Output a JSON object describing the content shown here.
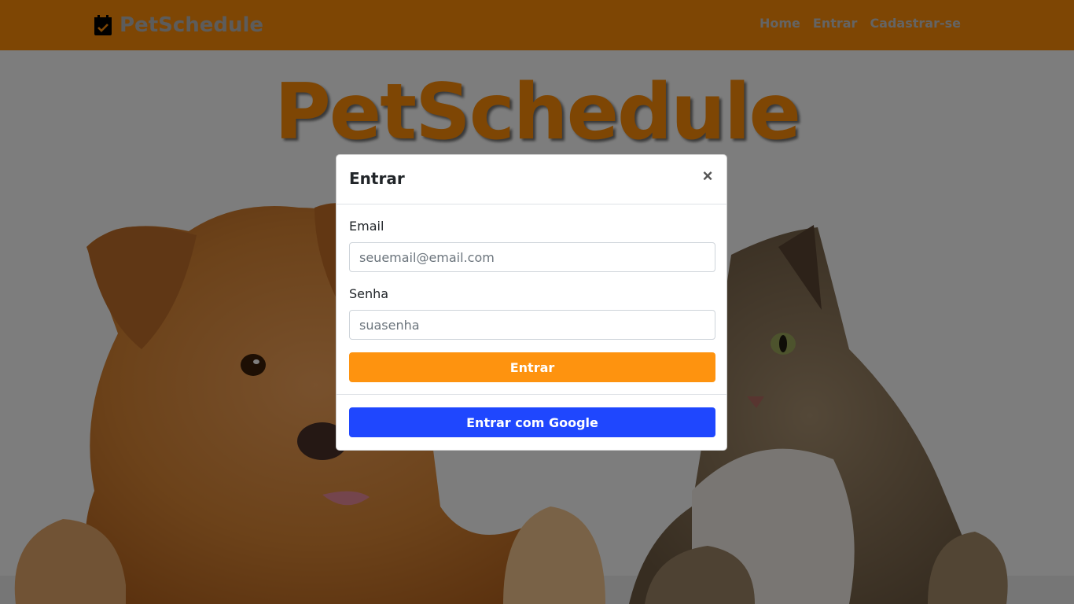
{
  "navbar": {
    "brand": "PetSchedule",
    "brand_icon": "calendar-check-icon",
    "links": [
      "Home",
      "Entrar",
      "Cadastrar-se"
    ]
  },
  "hero": {
    "title": "PetSchedule"
  },
  "modal": {
    "title": "Entrar",
    "close_label": "×",
    "email_label": "Email",
    "email_placeholder": "seuemail@email.com",
    "email_value": "",
    "password_label": "Senha",
    "password_placeholder": "suasenha",
    "password_value": "",
    "submit_label": "Entrar",
    "google_label": "Entrar com Google"
  },
  "colors": {
    "brand_orange": "#fc8c09",
    "button_orange": "#fe930f",
    "google_blue": "#1f47fe"
  }
}
